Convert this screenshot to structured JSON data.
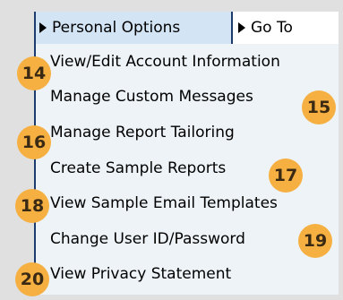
{
  "colors": {
    "panel_background": "#eef3f7",
    "active_tab_background": "#d3e4f5",
    "border": "#1b3a6e",
    "callout": "#f5b041",
    "page_background": "#e0e0e0"
  },
  "tabs": [
    {
      "label": "Personal Options",
      "icon": "triangle-right-icon",
      "active": true
    },
    {
      "label": "Go To",
      "icon": "triangle-right-icon",
      "active": false
    }
  ],
  "menu_items": [
    {
      "label": "View/Edit Account Information"
    },
    {
      "label": "Manage Custom Messages"
    },
    {
      "label": "Manage Report Tailoring"
    },
    {
      "label": "Create Sample Reports"
    },
    {
      "label": "View Sample Email Templates"
    },
    {
      "label": "Change User ID/Password"
    },
    {
      "label": "View Privacy Statement"
    }
  ],
  "callouts": [
    "14",
    "15",
    "16",
    "17",
    "18",
    "19",
    "20"
  ]
}
